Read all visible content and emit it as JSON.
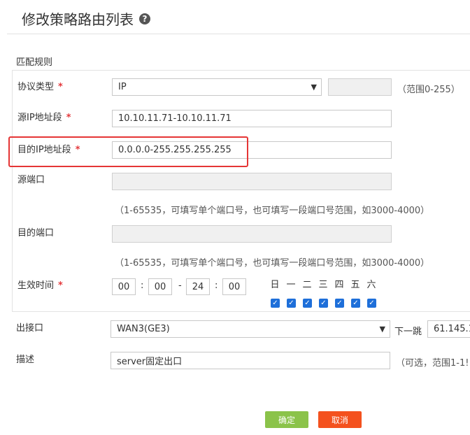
{
  "header": {
    "title": "修改策略路由列表",
    "help_icon": "?"
  },
  "section": {
    "label": "匹配规则"
  },
  "protocol": {
    "label": "协议类型",
    "value": "IP",
    "range_hint": "（范围0-255）"
  },
  "src_ip": {
    "label": "源IP地址段",
    "value": "10.10.11.71-10.10.11.71"
  },
  "dst_ip": {
    "label": "目的IP地址段",
    "value": "0.0.0.0-255.255.255.255"
  },
  "src_port": {
    "label": "源端口",
    "value": "",
    "hint": "（1-65535，可填写单个端口号，也可填写一段端口号范围，如3000-4000）"
  },
  "dst_port": {
    "label": "目的端口",
    "value": "",
    "hint": "（1-65535，可填写单个端口号，也可填写一段端口号范围，如3000-4000）"
  },
  "effective_time": {
    "label": "生效时间",
    "start_hour": "00",
    "start_minute": "00",
    "end_hour": "24",
    "end_minute": "00",
    "colon": ":",
    "dash": "-",
    "days": [
      "日",
      "一",
      "二",
      "三",
      "四",
      "五",
      "六"
    ],
    "checked": [
      true,
      true,
      true,
      true,
      true,
      true,
      true
    ]
  },
  "interface": {
    "label": "出接口",
    "value": "WAN3(GE3)",
    "next_hop_label": "下一跳",
    "next_hop_value": "61.145.1"
  },
  "description": {
    "label": "描述",
    "value": "server固定出口",
    "hint": "（可选，范围1-1!"
  },
  "actions": {
    "confirm": "确定",
    "cancel": "取消"
  },
  "colors": {
    "required": "#e4393c",
    "highlight": "#e53535",
    "confirm": "#8bc34a",
    "cancel": "#f4511e",
    "checkbox": "#1e6fd9"
  },
  "required_mark": "*"
}
